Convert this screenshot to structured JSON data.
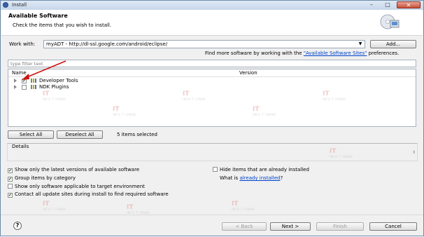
{
  "window": {
    "title": "Install",
    "controls": {
      "minimize": "–",
      "maximize": "□",
      "close": "✕"
    }
  },
  "header": {
    "title": "Available Software",
    "subtitle": "Check the items that you wish to install."
  },
  "work_with": {
    "label": "Work with:",
    "value": "myADT - http://dl-ssl.google.com/android/eclipse/",
    "add_button": "Add...",
    "hint_prefix": "Find more software by working with the ",
    "hint_link": "\"Available Software Sites\"",
    "hint_suffix": " preferences."
  },
  "filter": {
    "placeholder": "type filter text"
  },
  "tree": {
    "columns": [
      "Name",
      "Version"
    ],
    "items": [
      {
        "label": "Developer Tools",
        "checked": true
      },
      {
        "label": "NDK Plugins",
        "checked": false
      }
    ]
  },
  "selection": {
    "select_all": "Select All",
    "deselect_all": "Deselect All",
    "status": "5 items selected"
  },
  "details": {
    "label": "Details"
  },
  "options": {
    "latest_versions": {
      "label": "Show only the latest versions of available software",
      "checked": true
    },
    "group_by_category": {
      "label": "Group items by category",
      "checked": true
    },
    "applicable_only": {
      "label": "Show only software applicable to target environment",
      "checked": false
    },
    "contact_sites": {
      "label": "Contact all update sites during install to find required software",
      "checked": true
    },
    "hide_installed": {
      "label": "Hide items that are already installed",
      "checked": false
    },
    "what_is_prefix": "What is ",
    "what_is_link": "already installed",
    "what_is_suffix": "?"
  },
  "footer": {
    "help": "?",
    "back": "< Back",
    "next": "Next >",
    "finish": "Finish",
    "cancel": "Cancel"
  },
  "watermark": {
    "text": "IT",
    "sub": "INFO T IONNE"
  },
  "colors": {
    "accent": "#0044cc",
    "annotation_arrow": "#cc1111"
  }
}
